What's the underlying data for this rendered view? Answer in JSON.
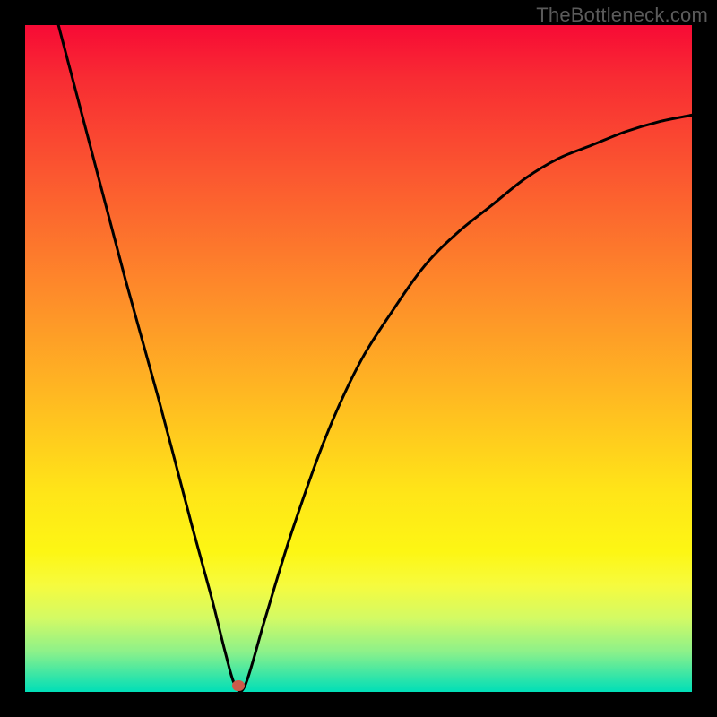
{
  "watermark": "TheBottleneck.com",
  "chart_data": {
    "type": "line",
    "title": "",
    "xlabel": "",
    "ylabel": "",
    "x_range": [
      0,
      100
    ],
    "y_range": [
      0,
      100
    ],
    "grid": false,
    "legend": false,
    "background_gradient": {
      "direction": "vertical",
      "top": "red",
      "middle": "yellow",
      "bottom": "green"
    },
    "series": [
      {
        "name": "bottleneck-curve",
        "color": "#000000",
        "x": [
          5,
          10,
          15,
          20,
          25,
          28,
          30,
          31.5,
          33,
          36,
          40,
          45,
          50,
          55,
          60,
          65,
          70,
          75,
          80,
          85,
          90,
          95,
          100
        ],
        "values": [
          100,
          81,
          62,
          44,
          25,
          14,
          6,
          1,
          1,
          11,
          24,
          38,
          49,
          57,
          64,
          69,
          73,
          77,
          80,
          82,
          84,
          85.5,
          86.5
        ]
      }
    ],
    "markers": [
      {
        "name": "minimum-point",
        "x": 32,
        "y": 1,
        "color": "#cc5a4a"
      }
    ]
  }
}
